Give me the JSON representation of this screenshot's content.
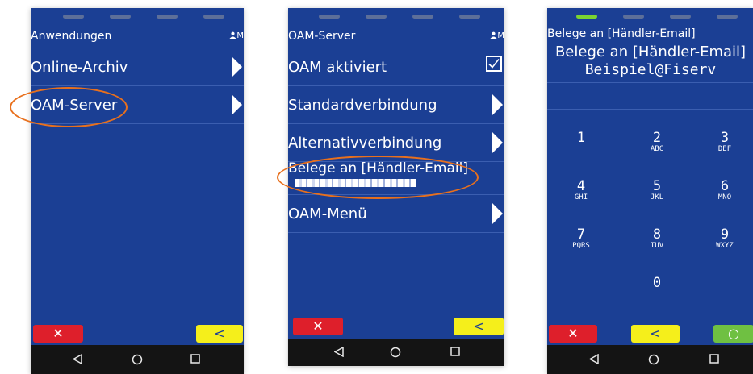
{
  "screen1": {
    "header_title": "Anwendungen",
    "user_label": "M",
    "items": [
      {
        "label": "Online-Archiv"
      },
      {
        "label": "OAM-Server"
      }
    ]
  },
  "screen2": {
    "header_title": "OAM-Server",
    "user_label": "M",
    "items": [
      {
        "label": "OAM aktiviert",
        "checked": true
      },
      {
        "label": "Standardverbindung"
      },
      {
        "label": "Alternativverbindung"
      },
      {
        "label": "Belege an [Händler-Email]"
      },
      {
        "label": "OAM-Menü"
      }
    ]
  },
  "screen3": {
    "header_title": "Belege an [Händler-Email]",
    "prompt": "Belege an [Händler-Email]",
    "value": "Beispiel@Fiserv",
    "keys": [
      {
        "num": "1",
        "letters": ""
      },
      {
        "num": "2",
        "letters": "ABC"
      },
      {
        "num": "3",
        "letters": "DEF"
      },
      {
        "num": "4",
        "letters": "GHI"
      },
      {
        "num": "5",
        "letters": "JKL"
      },
      {
        "num": "6",
        "letters": "MNO"
      },
      {
        "num": "7",
        "letters": "PQRS"
      },
      {
        "num": "8",
        "letters": "TUV"
      },
      {
        "num": "9",
        "letters": "WXYZ"
      },
      {
        "num": "0",
        "letters": ""
      }
    ]
  },
  "buttons": {
    "cancel_glyph": "✕",
    "back_glyph": "<",
    "ok_glyph": "○"
  },
  "colors": {
    "screen_bg": "#1b3f94",
    "highlight": "#e8701d",
    "cancel": "#de1f2b",
    "back": "#f5ef1b",
    "ok": "#6fc042"
  }
}
